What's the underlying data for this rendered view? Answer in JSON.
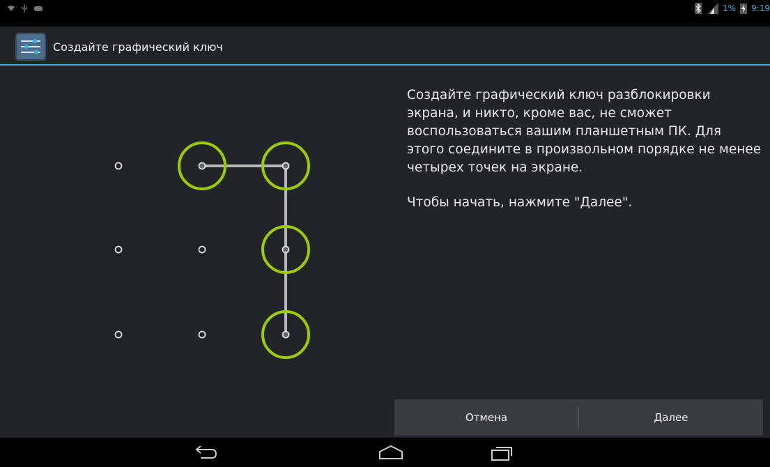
{
  "status_bar": {
    "battery_percent": "1%",
    "time": "9:19",
    "left_icons": [
      "wifi-icon",
      "usb-icon",
      "android-debug-icon"
    ],
    "right_icons": [
      "bluetooth-icon",
      "signal-icon",
      "battery-charging-icon"
    ]
  },
  "action_bar": {
    "title": "Создайте графический ключ",
    "icon": "settings-sliders-icon"
  },
  "pattern": {
    "grid_size": 3,
    "selected_dots": [
      1,
      2,
      5,
      8
    ],
    "path_order": [
      1,
      2,
      5,
      8
    ],
    "accent_color": "#9ccc00"
  },
  "description": {
    "paragraph1": "Создайте графический ключ разблокировки экрана, и никто, кроме вас, не сможет воспользоваться вашим планшетным ПК. Для этого соедините в произвольном порядке не менее четырех точек на экране.",
    "paragraph2": "Чтобы начать, нажмите \"Далее\"."
  },
  "buttons": {
    "cancel": "Отмена",
    "next": "Далее"
  },
  "nav_bar": {
    "icons": [
      "back-icon",
      "home-icon",
      "recent-apps-icon"
    ]
  }
}
